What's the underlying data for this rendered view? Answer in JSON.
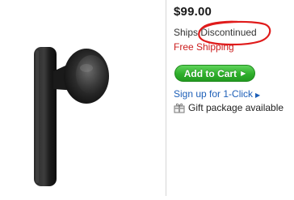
{
  "product": {
    "image_alt_icon": "bluetooth-headset-image",
    "price": "$99.00",
    "ships_label": "Ships:",
    "ships_value": "Discontinued",
    "free_shipping": "Free Shipping",
    "add_to_cart": "Add to Cart",
    "one_click": "Sign up for 1-Click",
    "gift_package": "Gift package available"
  },
  "colors": {
    "free_shipping": "#cc1f1f",
    "cart_button": "#2fae2b",
    "link": "#1d5fb8",
    "annotation": "#e01b1b"
  }
}
